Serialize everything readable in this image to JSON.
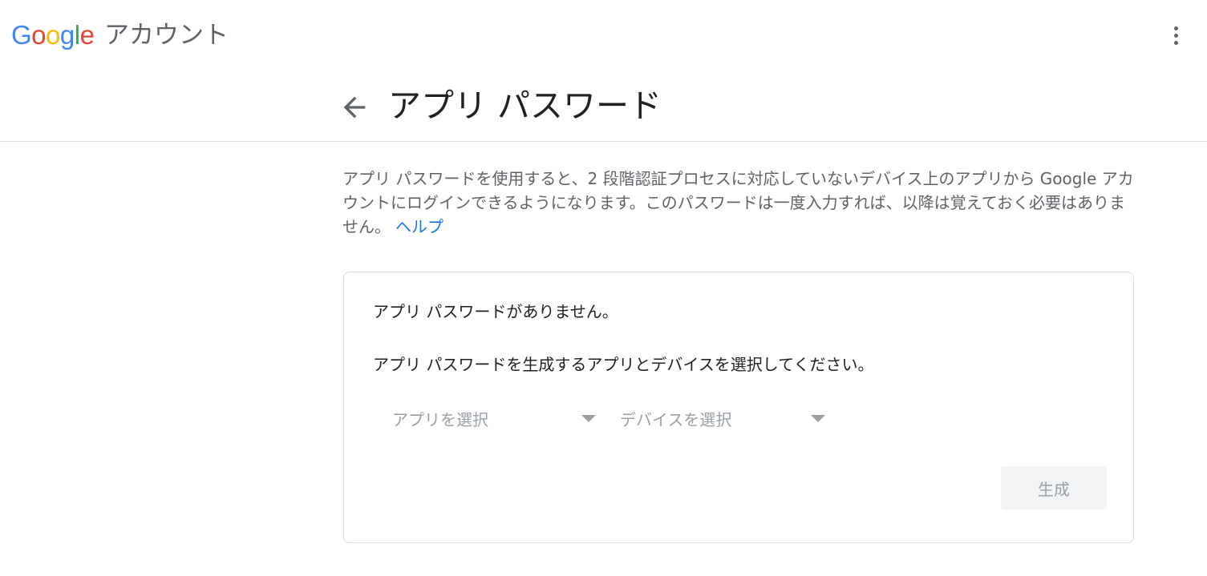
{
  "header": {
    "logo_letters": [
      "G",
      "o",
      "o",
      "g",
      "l",
      "e"
    ],
    "product_name": "アカウント",
    "more_menu_icon": "more-vert-icon"
  },
  "page": {
    "back_icon": "arrow-back-icon",
    "title": "アプリ パスワード",
    "description": "アプリ パスワードを使用すると、2 段階認証プロセスに対応していないデバイス上のアプリから Google アカウントにログインできるようになります。このパスワードは一度入力すれば、以降は覚えておく必要はありません。",
    "help_link": "ヘルプ"
  },
  "card": {
    "no_passwords": "アプリ パスワードがありません。",
    "instructions": "アプリ パスワードを生成するアプリとデバイスを選択してください。",
    "app_select": "アプリを選択",
    "device_select": "デバイスを選択",
    "generate_button": "生成"
  },
  "colors": {
    "link": "#1a73e8",
    "google_blue": "#4285f4",
    "google_red": "#ea4335",
    "google_yellow": "#fbbc05",
    "google_green": "#34a853"
  }
}
